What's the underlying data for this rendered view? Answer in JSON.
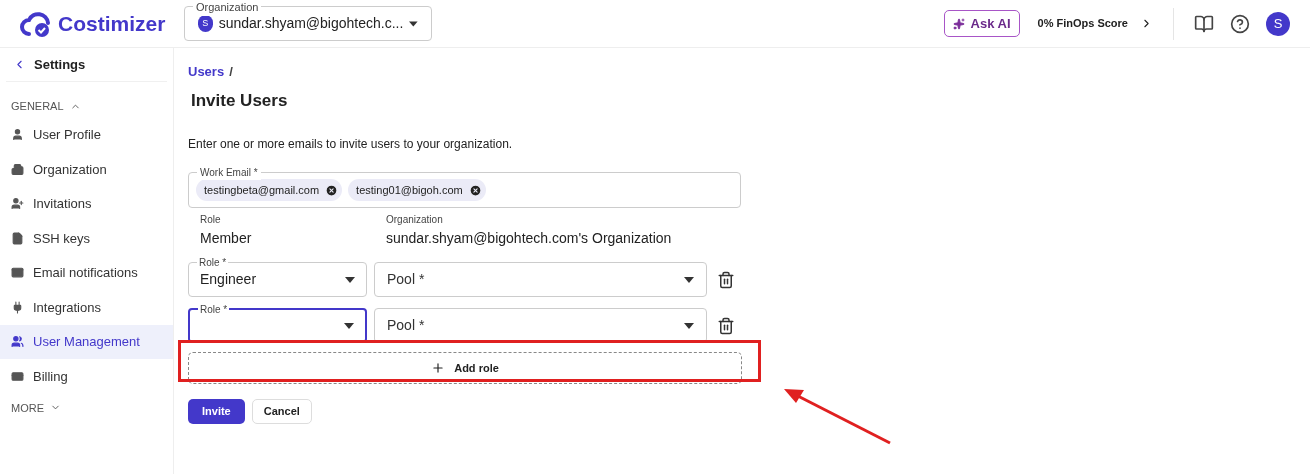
{
  "header": {
    "logo": "Costimizer",
    "organization": {
      "label": "Organization",
      "avatar": "S",
      "value": "sundar.shyam@bigohtech.c..."
    },
    "ask_ai": "Ask AI",
    "finops_score": "0% FinOps Score",
    "user_avatar": "S"
  },
  "sidebar": {
    "back": "Settings",
    "section": "GENERAL",
    "items": [
      {
        "label": "User Profile",
        "selected": false
      },
      {
        "label": "Organization",
        "selected": false
      },
      {
        "label": "Invitations",
        "selected": false
      },
      {
        "label": "SSH keys",
        "selected": false
      },
      {
        "label": "Email notifications",
        "selected": false
      },
      {
        "label": "Integrations",
        "selected": false
      },
      {
        "label": "User Management",
        "selected": true
      },
      {
        "label": "Billing",
        "selected": false
      }
    ],
    "more": "MORE"
  },
  "breadcrumb": [
    "Users",
    "/"
  ],
  "title": "Invite Users",
  "description": "Enter one or more emails to invite users to your organization.",
  "work_email": {
    "label": "Work Email *",
    "chips": [
      "testingbeta@gmail.com",
      "testing01@bigoh.com"
    ]
  },
  "defaults": [
    {
      "label": "Role",
      "value": "Member"
    },
    {
      "label": "Organization",
      "value": "sundar.shyam@bigohtech.com's Organization"
    }
  ],
  "role_rows": [
    {
      "role_label": "Role *",
      "role_value": "Engineer",
      "pool_placeholder": "Pool *",
      "focused": false
    },
    {
      "role_label": "Role *",
      "pool_placeholder": "Pool *",
      "focused": true
    }
  ],
  "add_role": "Add role",
  "actions": {
    "invite": "Invite",
    "cancel": "Cancel"
  }
}
